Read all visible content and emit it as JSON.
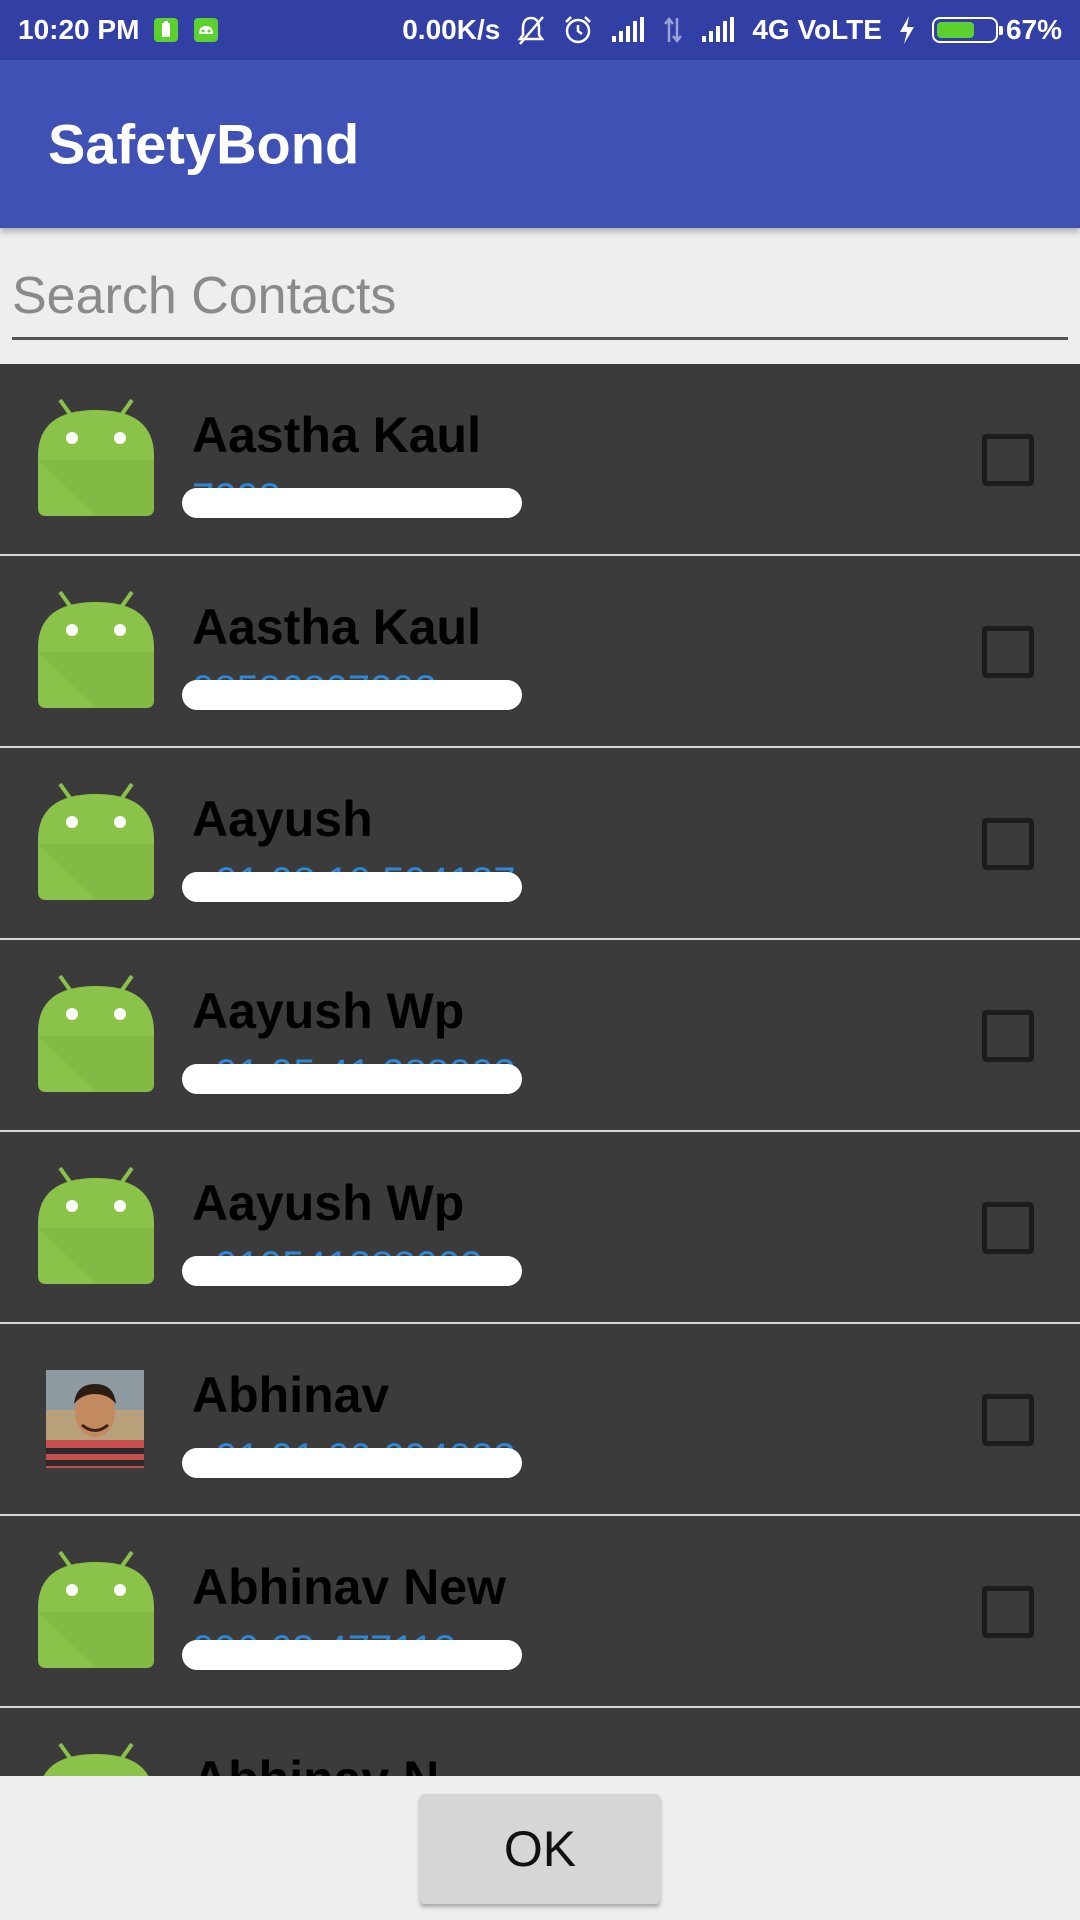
{
  "status_bar": {
    "time": "10:20 PM",
    "speed": "0.00K/s",
    "network": "4G VoLTE",
    "battery": "67%",
    "battery_level": 0.67
  },
  "app_bar": {
    "title": "SafetyBond"
  },
  "search": {
    "placeholder": "Search Contacts",
    "value": ""
  },
  "contacts": [
    {
      "name": "Aastha Kaul",
      "phone": "7293",
      "avatar": "android-icon",
      "checked": false
    },
    {
      "name": "Aastha Kaul",
      "phone": "08586807293",
      "avatar": "android-icon",
      "checked": false
    },
    {
      "name": "Aayush",
      "phone": "+91 98 10 594137",
      "avatar": "android-icon",
      "checked": false
    },
    {
      "name": "Aayush Wp",
      "phone": "+91 95 41 288002",
      "avatar": "android-icon",
      "checked": false
    },
    {
      "name": "Aayush Wp",
      "phone": "+919541288002",
      "avatar": "android-icon",
      "checked": false
    },
    {
      "name": "Abhinav",
      "phone": "+91 91 66 694033",
      "avatar": "photo",
      "checked": false
    },
    {
      "name": "Abhinav New",
      "phone": "096 63 477113",
      "avatar": "android-icon",
      "checked": false
    },
    {
      "name": "Abhinav N",
      "phone": "",
      "avatar": "android-icon",
      "checked": false
    }
  ],
  "footer": {
    "ok_label": "OK"
  },
  "colors": {
    "status_bar": "#3240a6",
    "app_bar": "#3f51b5",
    "list_bg": "#3b3b3b",
    "phone_text": "#2e88d6",
    "android_green": "#8bc34a"
  }
}
